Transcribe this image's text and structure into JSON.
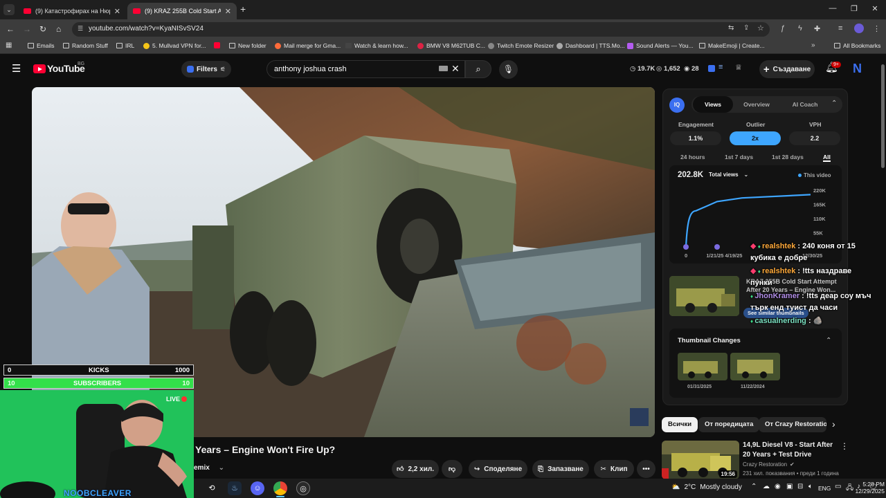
{
  "browser": {
    "tabs": [
      {
        "title": "(9) Катастрофирах на Нюр",
        "active": false
      },
      {
        "title": "(9) KRAZ 255B Cold Start At",
        "active": true
      }
    ],
    "url": "youtube.com/watch?v=KyaNISvSV24",
    "bookmarks": [
      "Emails",
      "Random Stuff",
      "IRL",
      "5. Mullvad VPN for...",
      "New folder",
      "Mail merge for Gma...",
      "Watch & learn how...",
      "BMW V8 M62TUB C...",
      "Twitch Emote Resizer",
      "Dashboard | TTS.Mo...",
      "Sound Alerts — You...",
      "MakeEmoji | Create..."
    ],
    "all_bookmarks": "All Bookmarks"
  },
  "youtube": {
    "logo_text": "YouTube",
    "region": "BG",
    "filters_label": "Filters",
    "search_query": "anthony joshua crash",
    "header_stats": {
      "views": "19.7K",
      "likes": "1,652",
      "watching": "28"
    },
    "create_label": "Създаване",
    "notifications_badge": "9+",
    "avatar_letter": "N"
  },
  "video": {
    "title": "Years – Engine Won't Fire Up?",
    "channel_partial": "emix",
    "likes": "2,2 хил.",
    "share": "Споделяне",
    "save": "Запазване",
    "clip": "Клип"
  },
  "vidiq": {
    "logo": "IQ",
    "tabs": [
      "Views",
      "Overview",
      "AI Coach"
    ],
    "active_tab": "Views",
    "metrics": [
      {
        "label": "Engagement",
        "value": "1.1%"
      },
      {
        "label": "Outlier",
        "value": "2x"
      },
      {
        "label": "VPH",
        "value": "2.2"
      }
    ],
    "ranges": [
      "24 hours",
      "1st 7 days",
      "1st 28 days",
      "All"
    ],
    "active_range": "All",
    "total": "202.8K",
    "total_select": "Total views",
    "legend": "This video",
    "similar_label": "See similar thumbnails",
    "similar_title": "KRAZ 255B Cold Start Attempt After 20 Years – Engine Won...",
    "thumbnail_changes_title": "Thumbnail Changes",
    "thumbnail_dates": [
      "01/31/2025",
      "11/22/2024"
    ]
  },
  "chart_data": {
    "type": "line",
    "x": [
      "0",
      "1/21/25",
      "4/19/25",
      "12/30/25"
    ],
    "y_ticks": [
      "220K",
      "165K",
      "110K",
      "55K"
    ],
    "series": [
      {
        "values": [
          0,
          140000,
          176000,
          190000,
          202800
        ]
      }
    ]
  },
  "chat": [
    {
      "user": "realshtek",
      "text": ": 240 коня от 15 кубика е добре"
    },
    {
      "user": "realshtek",
      "text": ": !tts наздраве пунки"
    },
    {
      "user": "JhonKramer",
      "text": ": !tts деар соу мъч търк енд туист да часи"
    },
    {
      "user": "casualnerding",
      "text": ":"
    }
  ],
  "chips": [
    "Всички",
    "От поредицата",
    "От Crazy Restoration"
  ],
  "recommended": {
    "title": "14,9L Diesel V8 - Start After 20 Years + Test Drive",
    "channel": "Crazy Restoration",
    "meta": "231 хил. показвания • преди 1 година",
    "duration": "19:56"
  },
  "overlay": {
    "kicks_left": "0",
    "kicks_label": "KICKS",
    "kicks_right": "1000",
    "subs_left": "10",
    "subs_label": "SUBSCRIBERS",
    "subs_right": "10",
    "live": "LIVE",
    "name": "NOOBCLEAVER"
  },
  "taskbar": {
    "weather_temp": "2°C",
    "weather_desc": "Mostly cloudy",
    "lang": "ENG",
    "time": "5:28 PM",
    "date": "12/29/2025"
  },
  "colors": {
    "accent": "#3ea6ff",
    "youtube_red": "#ff0033",
    "green_screen": "#22e06a"
  }
}
